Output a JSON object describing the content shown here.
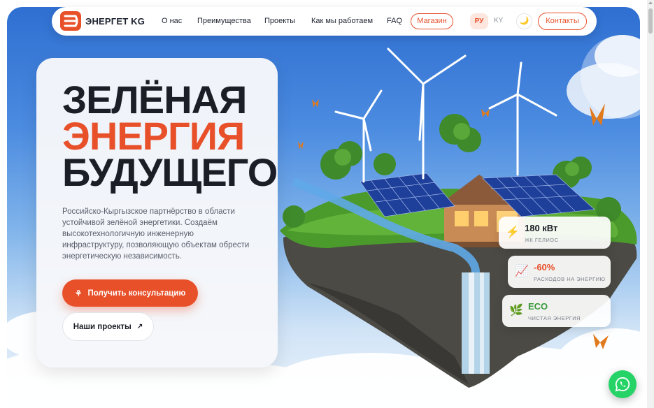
{
  "brand": {
    "name": "ЭНЕРГЕТ KG",
    "accent": "#e8502a",
    "dark": "#1b1e26"
  },
  "nav": {
    "links": [
      "О нас",
      "Преимущества",
      "Проекты",
      "Как мы работаем",
      "FAQ"
    ],
    "shop_label": "Магазин",
    "lang_active": "РУ",
    "lang_other": "KY",
    "contacts_label": "Контакты",
    "theme_icon": "moon-icon"
  },
  "hero": {
    "headline_line1": "ЗЕЛЁНАЯ",
    "headline_line2": "ЭНЕРГИЯ",
    "headline_line3": "БУДУЩЕГО",
    "description": "Российско-Кыргызское партнёрство в области устойчивой зелёной энергетики. Создаём высокотехнологичную инженерную инфраструктуру, позволяющую объектам обрести энергетическую независимость.",
    "consult_button": "Получить консультацию",
    "projects_button": "Наши проекты"
  },
  "stats": [
    {
      "icon": "lightning-icon",
      "value": "180 кВт",
      "label": "ЖК ГЕЛИОС",
      "value_color": "#1b1e26"
    },
    {
      "icon": "chart-up-icon",
      "value": "-60%",
      "label": "РАСХОДОВ НА ЭНЕРГИЮ",
      "value_color": "#e8502a"
    },
    {
      "icon": "leaf-icon",
      "value": "ECO",
      "label": "ЧИСТАЯ ЭНЕРГИЯ",
      "value_color": "#3a9a3a"
    }
  ],
  "floating": {
    "whatsapp_icon": "whatsapp-icon",
    "whatsapp_color": "#25d366"
  }
}
